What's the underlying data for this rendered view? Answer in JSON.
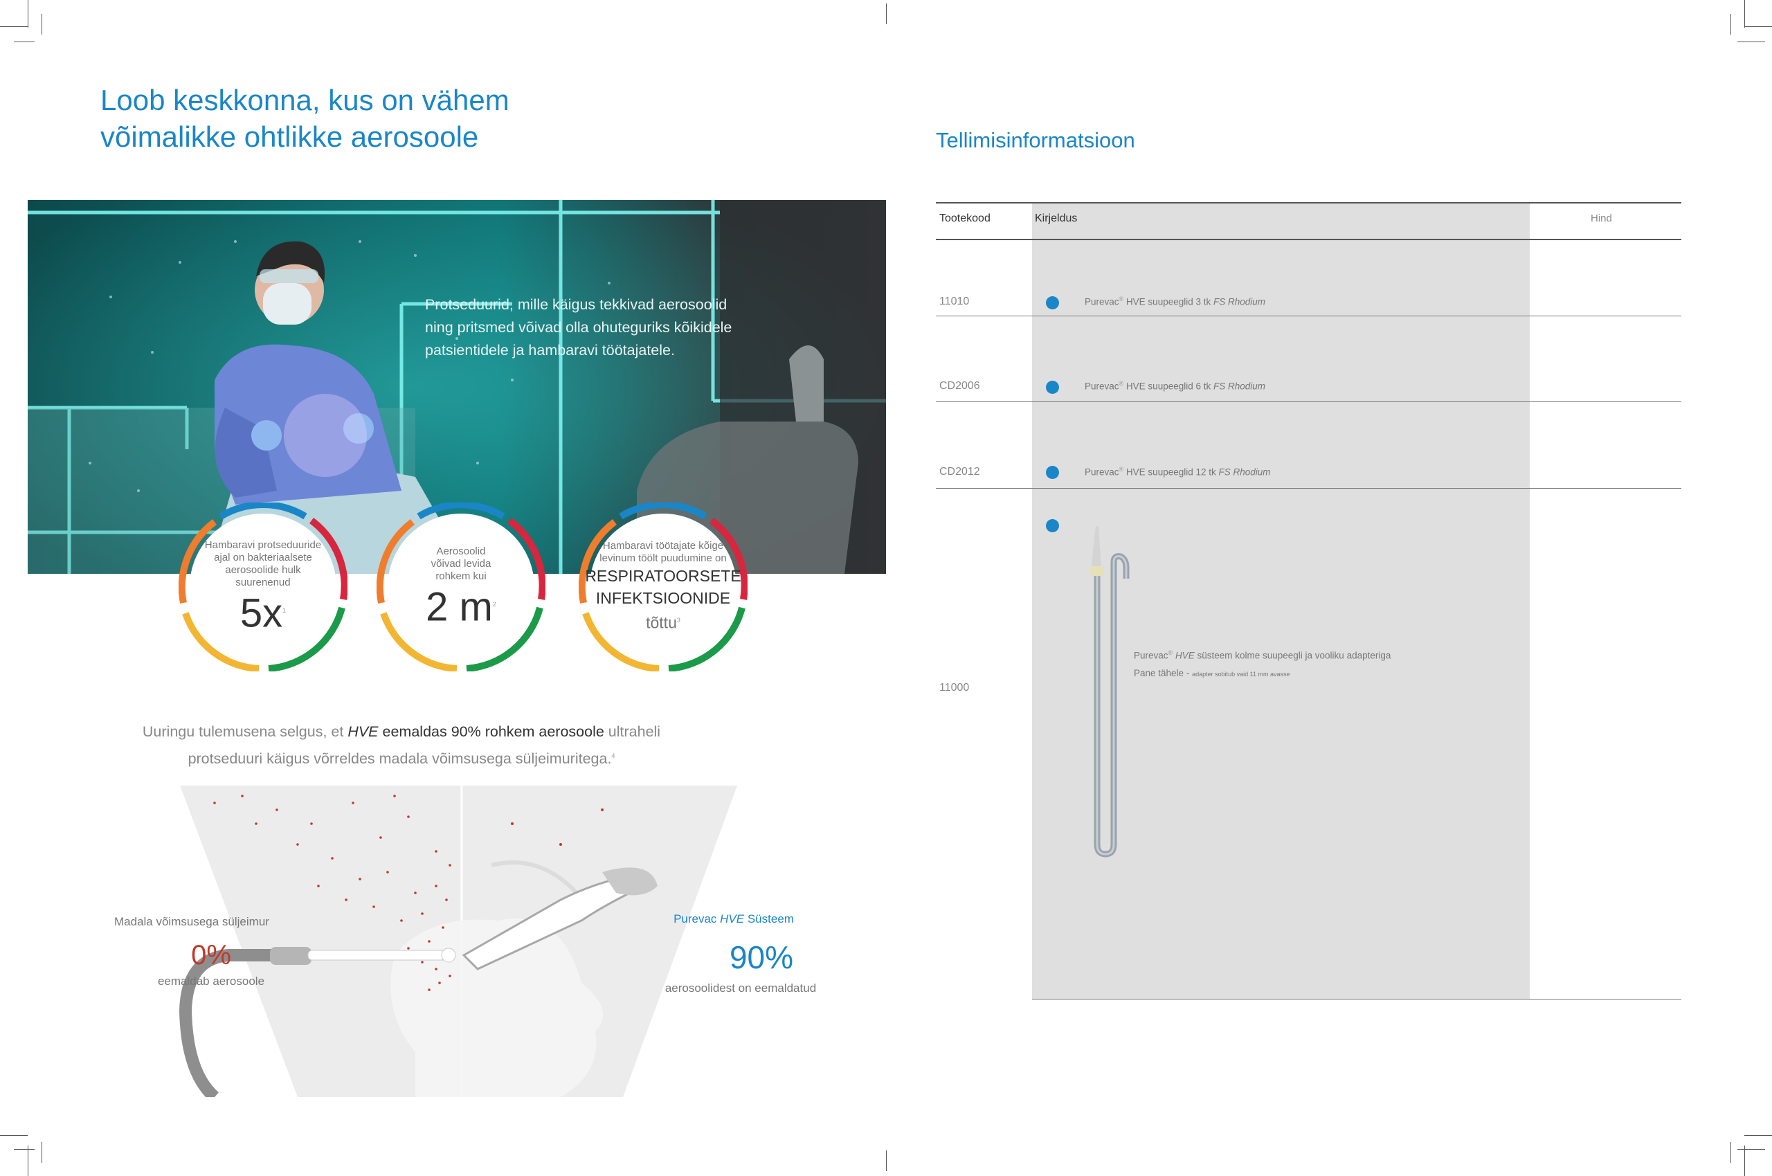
{
  "left_page": {
    "title_line1": "Loob keskkonna, kus on vähem",
    "title_line2": "võimalikke ohtlikke aerosoole",
    "hero_text": "Protseduurid, mille käigus tekkivad aerosoolid ning pritsmed võivad olla ohuteguriks kõikidele patsientidele ja hambaravi töötajatele.",
    "stats": [
      {
        "small": "Hambaravi protseduuride ajal on bakteriaalsete aerosoolide hulk suurenenud",
        "big": "5x",
        "ref": "1"
      },
      {
        "small": "Aerosoolid võivad levida rohkem kui",
        "big": "2 m",
        "ref": "2"
      },
      {
        "small": "Hambaravi töötajate kõige levinum töölt puudumine on",
        "caps1": "RESPIRATOORSETE",
        "caps2": "INFEKTSIOONIDE",
        "tail": "tõttu",
        "ref": "3"
      }
    ],
    "study_pre": "Uuringu tulemusena selgus, et ",
    "study_hve": "HVE",
    "study_bold": " eemaldas 90% rohkem aerosoole",
    "study_post": " ultraheli protseduuri käigus võrreldes madala võimsusega süljeimuritega.",
    "study_ref": "4",
    "low_label": "Madala võimsusega süljeimur",
    "low_pct": "0%",
    "low_sub": "eemaldab aerosoole",
    "high_label_pre": "Purevac ",
    "high_label_em": "HVE",
    "high_label_post": " Süsteem",
    "high_pct": "90%",
    "high_sub": "aerosoolidest on eemaldatud"
  },
  "right_page": {
    "title": "Tellimisinformatsioon",
    "headers": {
      "code": "Tootekood",
      "desc": "Kirjeldus",
      "price": "Hind"
    },
    "rows": [
      {
        "code": "11010",
        "brand": "Purevac",
        "reg": "®",
        "text": " HVE suupeeglid 3 tk ",
        "em": "FS Rhodium"
      },
      {
        "code": "CD2006",
        "brand": "Purevac",
        "reg": "®",
        "text": " HVE suupeeglid 6 tk ",
        "em": "FS Rhodium"
      },
      {
        "code": "CD2012",
        "brand": "Purevac",
        "reg": "®",
        "text": " HVE suupeeglid 12 tk ",
        "em": "FS Rhodium"
      }
    ],
    "last_row": {
      "code": "11000",
      "brand": "Purevac",
      "reg": "®",
      "em": "HVE",
      "text": " süsteem kolme suupeegli ja vooliku adapteriga",
      "note_label": "Pane tähele - ",
      "note_small": "adapter sobitub vaid 11 mm avasse"
    }
  },
  "colors": {
    "accent": "#1a86c8",
    "red": "#c0392b",
    "ring_blue": "#1a86c8",
    "ring_red": "#d7263d",
    "ring_green": "#1b9a4a",
    "ring_yellow": "#f2b632",
    "ring_orange": "#ef7d2d"
  }
}
